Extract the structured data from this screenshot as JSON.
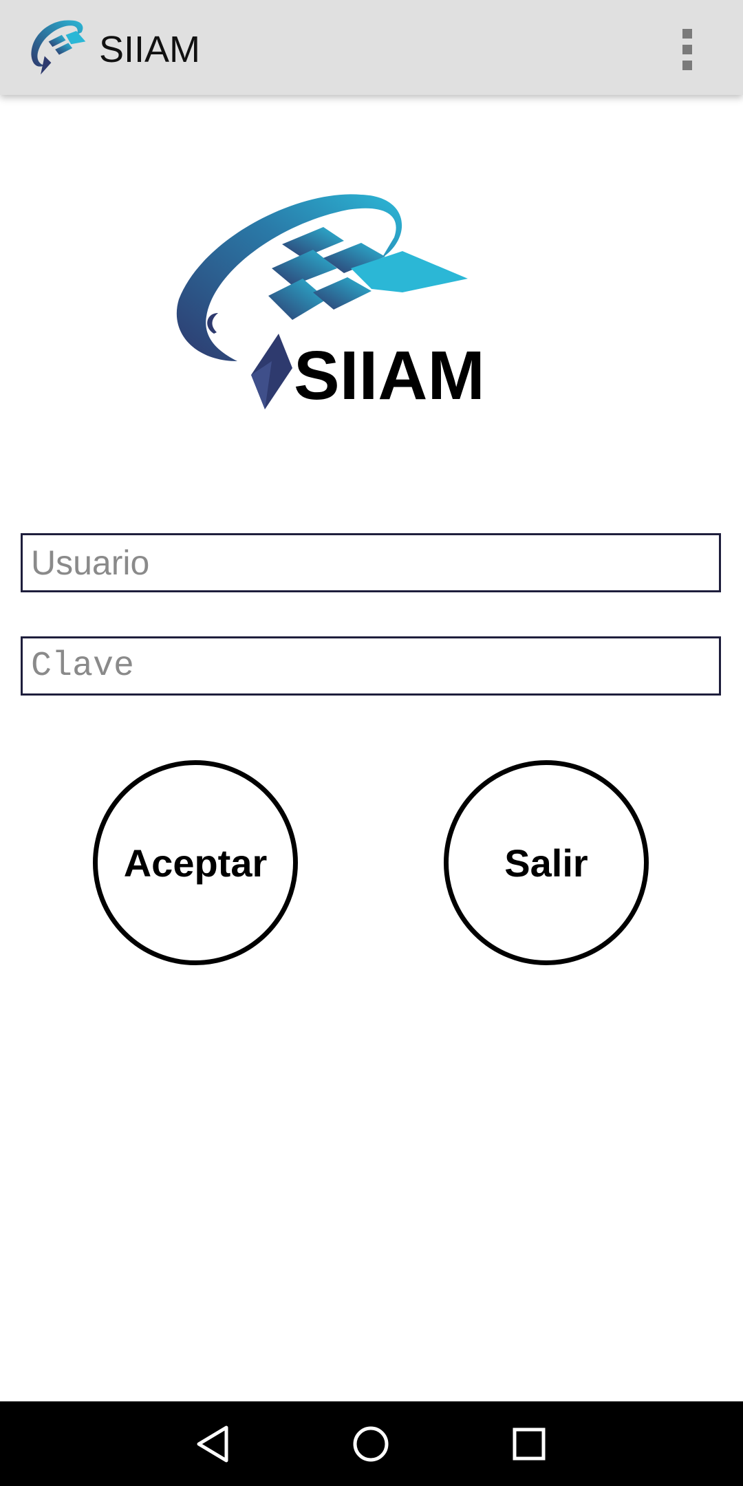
{
  "appbar": {
    "title": "SIIAM",
    "logo_icon": "siiam-logo-icon",
    "overflow_icon": "more-vert-icon"
  },
  "logo": {
    "wordmark": "SIIAM",
    "colors": {
      "teal": "#2bb7d6",
      "navy": "#2e3a6e"
    }
  },
  "form": {
    "username_placeholder": "Usuario",
    "username_value": "",
    "password_placeholder": "Clave",
    "password_value": ""
  },
  "buttons": {
    "accept_label": "Aceptar",
    "exit_label": "Salir"
  },
  "navbar": {
    "back_icon": "back-icon",
    "home_icon": "home-icon",
    "recents_icon": "recents-icon"
  },
  "colors": {
    "appbar_bg": "#e0e0e0",
    "field_border": "#1e1e3c",
    "navbar_bg": "#000000"
  }
}
